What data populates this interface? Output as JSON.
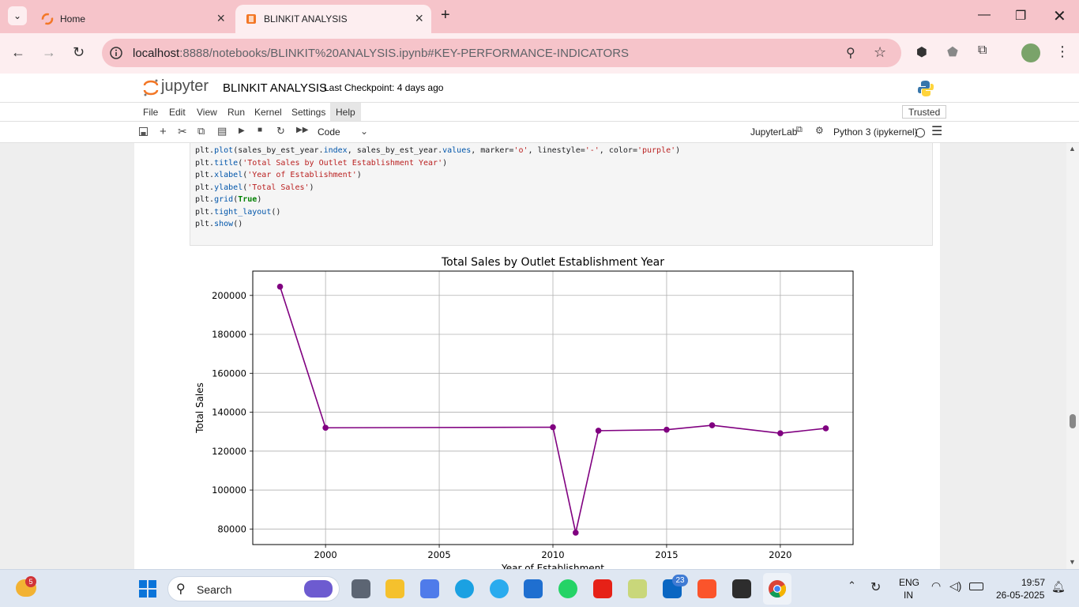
{
  "browser": {
    "tabs": [
      {
        "title": "Home"
      },
      {
        "title": "BLINKIT ANALYSIS"
      }
    ],
    "url_host": "localhost",
    "url_rest": ":8888/notebooks/BLINKIT%20ANALYSIS.ipynb#KEY-PERFORMANCE-INDICATORS"
  },
  "jupyter": {
    "logo_text": "jupyter",
    "notebook_title": "BLINKIT ANALYSIS",
    "checkpoint": "Last Checkpoint: 4 days ago",
    "menu": [
      "File",
      "Edit",
      "View",
      "Run",
      "Kernel",
      "Settings",
      "Help"
    ],
    "trusted": "Trusted",
    "cell_type": "Code",
    "jupyterlab_link": "JupyterLab",
    "kernel": "Python 3 (ipykernel)"
  },
  "code_lines": [
    "plt.plot(sales_by_est_year.index, sales_by_est_year.values, marker='o', linestyle='-', color='purple')",
    "plt.title('Total Sales by Outlet Establishment Year')",
    "plt.xlabel('Year of Establishment')",
    "plt.ylabel('Total Sales')",
    "plt.grid(True)",
    "plt.tight_layout()",
    "plt.show()"
  ],
  "chart_data": {
    "type": "line",
    "title": "Total Sales by Outlet Establishment Year",
    "xlabel": "Year of Establishment",
    "ylabel": "Total Sales",
    "color": "#800080",
    "marker": "o",
    "grid": true,
    "x": [
      1998,
      2000,
      2010,
      2011,
      2012,
      2015,
      2017,
      2020,
      2022
    ],
    "y": [
      204500,
      132000,
      132300,
      78100,
      130500,
      131000,
      133300,
      129200,
      131700
    ],
    "xlim": [
      1996.8,
      2023.2
    ],
    "ylim": [
      72000,
      212500
    ],
    "xticks": [
      2000,
      2005,
      2010,
      2015,
      2020
    ],
    "yticks": [
      80000,
      100000,
      120000,
      140000,
      160000,
      180000,
      200000
    ]
  },
  "taskbar": {
    "search_label": "Search",
    "lang": "ENG",
    "region": "IN",
    "time": "19:57",
    "date": "26-05-2025",
    "weather_badge": "5",
    "linkedin_badge": "23"
  }
}
